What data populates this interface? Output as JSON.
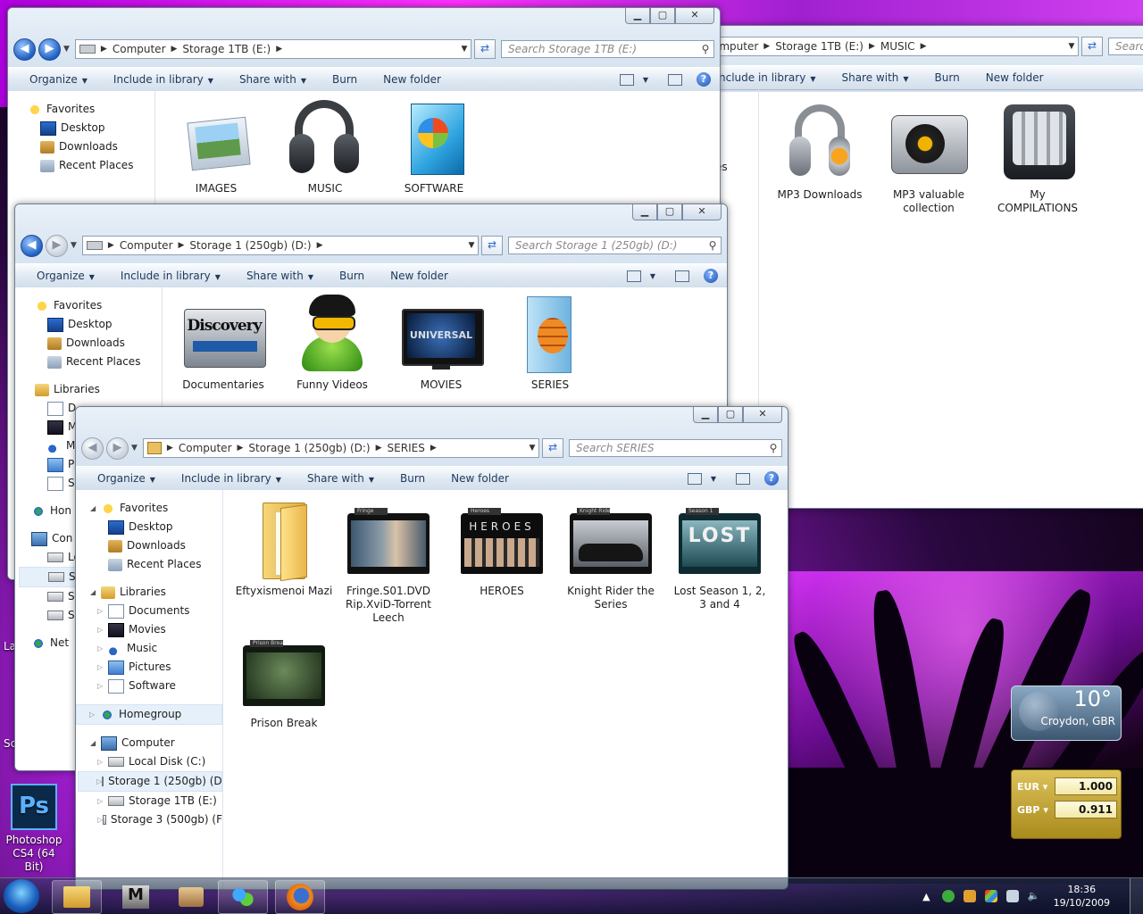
{
  "common": {
    "organize": "Organize",
    "include_in_library": "Include in library",
    "share_with": "Share with",
    "burn": "Burn",
    "new_folder": "New folder"
  },
  "window_music": {
    "address": [
      "omputer",
      "Storage 1TB (E:)",
      "MUSIC"
    ],
    "search_placeholder": "Search",
    "toolbar": [
      "nclude in library",
      "Share with",
      "Burn",
      "New folder"
    ],
    "items": [
      {
        "label": "MP3 Downloads",
        "icon": "headphones-icon"
      },
      {
        "label": "MP3 valuable collection",
        "icon": "turntable-icon"
      },
      {
        "label": "My COMPILATIONS",
        "icon": "mixer-icon"
      }
    ],
    "partial_label": "es"
  },
  "window_e": {
    "address": [
      "Computer",
      "Storage 1TB (E:)"
    ],
    "search_placeholder": "Search Storage 1TB (E:)",
    "nav": [
      {
        "label": "Favorites",
        "icon": "star-icon"
      },
      {
        "label": "Desktop",
        "icon": "desktop-icon"
      },
      {
        "label": "Downloads",
        "icon": "downloads-icon"
      },
      {
        "label": "Recent Places",
        "icon": "recent-places-icon"
      }
    ],
    "items": [
      {
        "label": "IMAGES",
        "icon": "photo-frame-icon"
      },
      {
        "label": "MUSIC",
        "icon": "headphones-icon"
      },
      {
        "label": "SOFTWARE",
        "icon": "windows-box-icon"
      }
    ]
  },
  "window_d": {
    "address": [
      "Computer",
      "Storage 1 (250gb) (D:)"
    ],
    "search_placeholder": "Search Storage 1 (250gb) (D:)",
    "nav": [
      {
        "label": "Favorites"
      },
      {
        "label": "Desktop"
      },
      {
        "label": "Downloads"
      },
      {
        "label": "Recent Places"
      },
      {
        "label": "Libraries"
      },
      {
        "label": "D"
      },
      {
        "label": "M"
      },
      {
        "label": "M"
      },
      {
        "label": "Pi"
      },
      {
        "label": "Sc"
      },
      {
        "label": "Hon"
      },
      {
        "label": "Con"
      },
      {
        "label": "Lo"
      },
      {
        "label": "St"
      },
      {
        "label": "St"
      },
      {
        "label": "St"
      },
      {
        "label": "Net"
      }
    ],
    "items": [
      {
        "label": "Documentaries",
        "icon": "discovery-channel-icon"
      },
      {
        "label": "Funny Videos",
        "icon": "cartoon-avatar-icon"
      },
      {
        "label": "MOVIES",
        "icon": "tv-universal-icon"
      },
      {
        "label": "SERIES",
        "icon": "film-folder-icon"
      }
    ]
  },
  "window_series": {
    "address": [
      "Computer",
      "Storage 1 (250gb) (D:)",
      "SERIES"
    ],
    "search_placeholder": "Search SERIES",
    "nav": {
      "favorites": "Favorites",
      "desktop": "Desktop",
      "downloads": "Downloads",
      "recent": "Recent Places",
      "libraries": "Libraries",
      "documents": "Documents",
      "movies": "Movies",
      "music": "Music",
      "pictures": "Pictures",
      "software": "Software",
      "homegroup": "Homegroup",
      "computer": "Computer",
      "drive_c": "Local Disk (C:)",
      "drive_d": "Storage 1 (250gb) (D",
      "drive_e": "Storage 1TB (E:)",
      "drive_f": "Storage 3 (500gb) (F"
    },
    "items": [
      {
        "label": "Eftyxismenoi Mazi",
        "tag": ""
      },
      {
        "label": "Fringe.S01.DVDRip.XviD-TorrentLeech",
        "tag": "Fringe"
      },
      {
        "label": "HEROES",
        "tag": "Heroes"
      },
      {
        "label": "Knight Rider the Series",
        "tag": "Knight Rider"
      },
      {
        "label": "Lost Season 1, 2, 3 and 4",
        "tag": "Season 1"
      },
      {
        "label": "Prison Break",
        "tag": "Prison Break"
      }
    ]
  },
  "desktop": {
    "photoshop_label": "Photoshop CS4 (64 Bit)",
    "edge_label_la": "La",
    "edge_label_sc": "Sc"
  },
  "gadgets": {
    "weather": {
      "temp": "10°",
      "city": "Croydon, GBR"
    },
    "currency": [
      {
        "code": "EUR",
        "value": "1.000"
      },
      {
        "code": "GBP",
        "value": "0.911"
      }
    ]
  },
  "taskbar": {
    "time": "18:36",
    "date": "19/10/2009"
  }
}
